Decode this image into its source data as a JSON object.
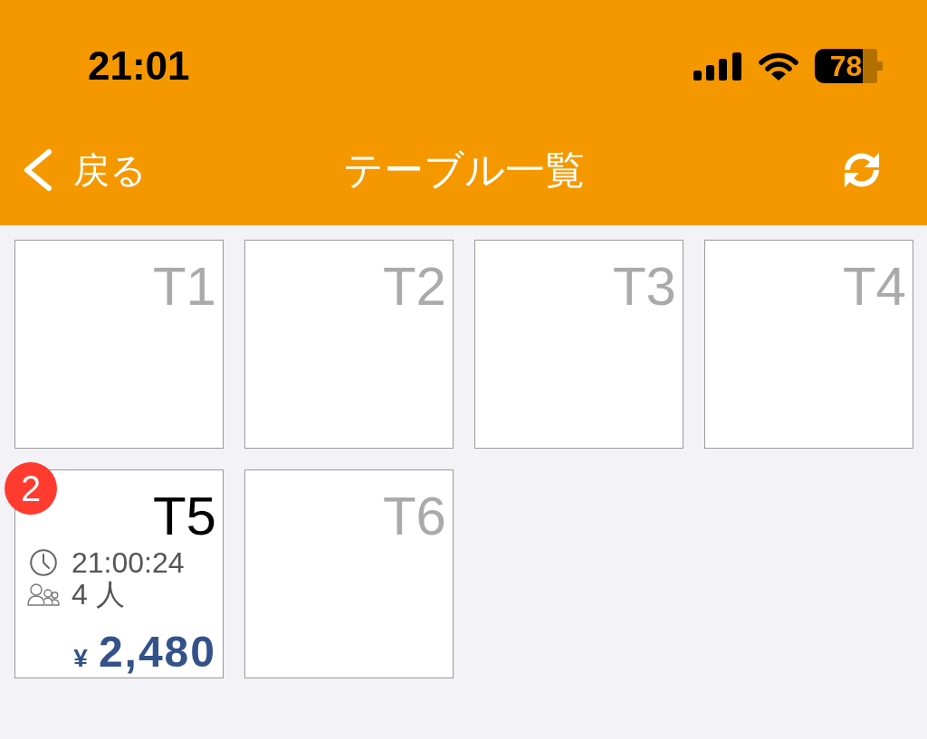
{
  "status_bar": {
    "time": "21:01",
    "battery": "78"
  },
  "nav_bar": {
    "back": "戻る",
    "title": "テーブル一覧"
  },
  "tables": [
    {
      "name": "T1",
      "occupied": false
    },
    {
      "name": "T2",
      "occupied": false
    },
    {
      "name": "T3",
      "occupied": false
    },
    {
      "name": "T4",
      "occupied": false
    },
    {
      "name": "T5",
      "occupied": true,
      "badge": "2",
      "time": "21:00:24",
      "guests": "4 人",
      "currency": "¥",
      "amount": "2,480"
    },
    {
      "name": "T6",
      "occupied": false
    }
  ]
}
